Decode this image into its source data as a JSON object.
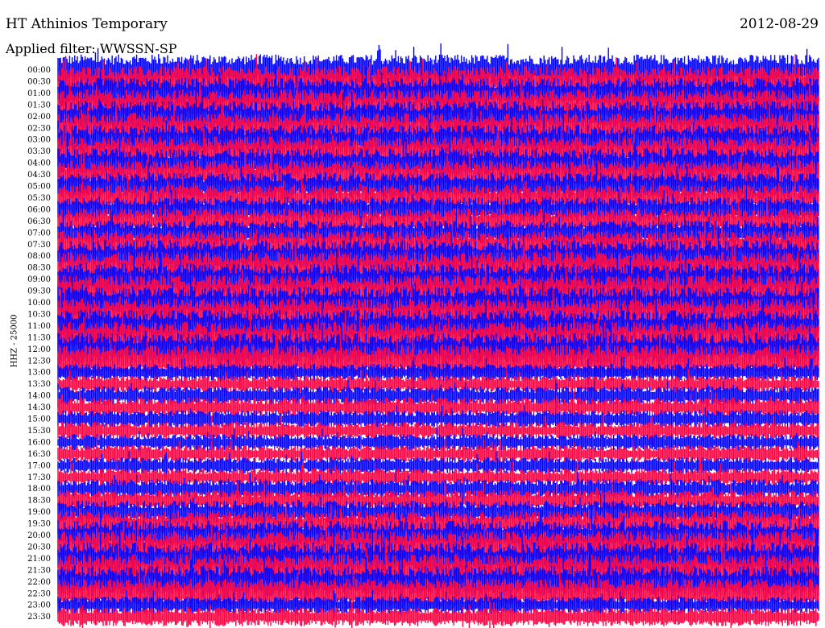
{
  "header": {
    "station": "HT Athinios Temporary",
    "date": "2012-08-29",
    "filter_label": "Applied filter:",
    "filter_value": "WWSSN-SP"
  },
  "colors": {
    "trace_a": "#0000ff",
    "trace_b": "#ff0040",
    "background": "#ffffff",
    "text": "#000000"
  },
  "chart_data": {
    "type": "helicorder",
    "ylabel": "HHZ - 25000",
    "y_tick_labels": [
      "00:00",
      "00:30",
      "01:00",
      "01:30",
      "02:00",
      "02:30",
      "03:00",
      "03:30",
      "04:00",
      "04:30",
      "05:00",
      "05:30",
      "06:00",
      "06:30",
      "07:00",
      "07:30",
      "08:00",
      "08:30",
      "09:00",
      "09:30",
      "10:00",
      "10:30",
      "11:00",
      "11:30",
      "12:00",
      "12:30",
      "13:00",
      "13:30",
      "14:00",
      "14:30",
      "15:00",
      "15:30",
      "16:00",
      "16:30",
      "17:00",
      "17:30",
      "18:00",
      "18:30",
      "19:00",
      "19:30",
      "20:00",
      "20:30",
      "21:00",
      "21:30",
      "22:00",
      "22:30",
      "23:00",
      "23:30"
    ],
    "line_colors_alternate": [
      "#0000ff",
      "#ff0040"
    ],
    "rows_saturated_fraction": [
      0.95,
      0.95,
      0.95,
      0.95,
      0.95,
      0.92,
      0.9,
      0.9,
      0.88,
      0.85,
      0.8,
      0.75,
      0.7,
      0.7,
      0.7,
      0.8,
      1.0,
      1.0,
      1.0,
      1.0,
      1.0,
      1.0,
      1.0,
      1.0,
      1.0,
      1.0,
      0.35,
      0.35,
      0.4,
      0.45,
      0.35,
      0.35,
      0.3,
      0.35,
      0.3,
      0.35,
      0.45,
      0.5,
      0.6,
      0.7,
      0.9,
      1.0,
      1.0,
      1.0,
      1.0,
      0.9,
      0.35,
      0.4
    ]
  }
}
